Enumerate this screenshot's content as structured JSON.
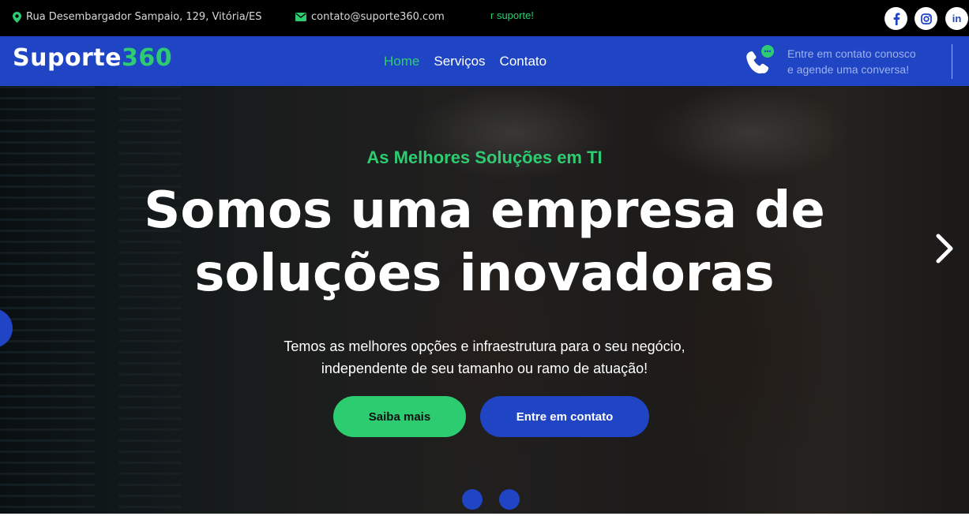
{
  "topbar": {
    "address": "Rua Desembargador Sampaio, 129, Vitória/ES",
    "email": "contato@suporte360.com",
    "ticker": "r suporte!",
    "social": [
      {
        "icon": "facebook-icon",
        "glyph": "f"
      },
      {
        "icon": "instagram-icon",
        "glyph": ""
      },
      {
        "icon": "linkedin-icon",
        "glyph": "in"
      }
    ]
  },
  "navbar": {
    "logo_main": "Suporte",
    "logo_accent": "360",
    "links": [
      {
        "label": "Home",
        "active": true
      },
      {
        "label": "Serviços",
        "active": false
      },
      {
        "label": "Contato",
        "active": false
      }
    ],
    "cta_line1": "Entre em contato conosco",
    "cta_line2": "e agende uma conversa!"
  },
  "hero": {
    "kicker": "As Melhores Soluções em TI",
    "headline_line1": "Somos uma empresa de",
    "headline_line2": "soluções inovadoras",
    "subtext_line1": "Temos as melhores opções e infraestrutura para o seu negócio,",
    "subtext_line2": "independente de seu tamanho ou ramo de atuação!",
    "primary_button": "Saiba mais",
    "secondary_button": "Entre em contato",
    "slides_count": 2
  },
  "colors": {
    "brand_blue": "#1f44c4",
    "accent_green": "#2ecc71",
    "topbar_bg": "#000000"
  }
}
